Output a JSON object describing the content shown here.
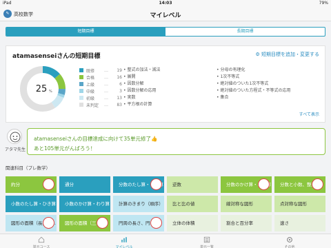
{
  "status_bar": {
    "device": "iPad",
    "time": "14:03",
    "battery": "79%"
  },
  "nav": {
    "app_label": "高校数学",
    "title": "マイレベル"
  },
  "segments": {
    "short_term": "短期目標",
    "long_term": "長期目標"
  },
  "goal_card": {
    "title": "atamasenseiさんの短期目標",
    "add_change": "短期目標を追加・変更する",
    "percent": "25",
    "percent_unit": "%",
    "legend": [
      {
        "name": "既修",
        "count": "19",
        "color": "#2a9fbe"
      },
      {
        "name": "合格",
        "count": "16",
        "color": "#8cc63f"
      },
      {
        "name": "上級",
        "count": "6",
        "color": "#5aa5c8"
      },
      {
        "name": "中級",
        "count": "3",
        "color": "#9fd6e8"
      },
      {
        "name": "初級",
        "count": "13",
        "color": "#cde8f2"
      },
      {
        "name": "未判定",
        "count": "83",
        "color": "#e0e0e0"
      }
    ],
    "topics_col1": [
      "整式の加法・減法",
      "展開",
      "因数分解",
      "因数分解の応用",
      "実数",
      "平方根の計算"
    ],
    "topics_col2": [
      "分母の有理化",
      "1次不等式",
      "絶対値のついた1次不等式",
      "絶対値のついた方程式・不等式の応用",
      "集合"
    ],
    "see_all": "すべて表示"
  },
  "teacher": {
    "label": "アタマ先生",
    "line1": "atamasenseiさんの目標達成に向けて35単元修了👍",
    "line2": "あと105単元がんばろう！"
  },
  "related_heading": "関連科目（プレ数学）",
  "tiles": [
    [
      {
        "label": "約分",
        "style": "green",
        "badge": true
      },
      {
        "label": "通分",
        "style": "dark",
        "badge": false
      },
      {
        "label": "分数のたし算・ひき算",
        "style": "dark",
        "badge": true
      },
      {
        "label": "逆数",
        "style": "lightg",
        "badge": false
      },
      {
        "label": "分数のかけ算・わり算",
        "style": "green",
        "badge": true
      },
      {
        "label": "分数と小数、整数",
        "style": "green",
        "badge": true
      }
    ],
    [
      {
        "label": "小数のたし算・ひき算",
        "style": "dark",
        "badge": false
      },
      {
        "label": "小数のかけ算・わり算",
        "style": "dark",
        "badge": false
      },
      {
        "label": "計算のきまり（順序）",
        "style": "lightb",
        "badge": false
      },
      {
        "label": "比と比の値",
        "style": "lightg",
        "badge": false
      },
      {
        "label": "線対称な図形",
        "style": "lightg",
        "badge": false
      },
      {
        "label": "点対称な図形",
        "style": "lightg",
        "badge": false
      }
    ],
    [
      {
        "label": "図形の面積（長方形…",
        "style": "lightb",
        "badge": true
      },
      {
        "label": "図形の面積（三…",
        "style": "green",
        "badge": true
      },
      {
        "label": "円周の長さ、円…",
        "style": "lightb",
        "badge": true
      },
      {
        "label": "立体の体積",
        "style": "pale",
        "badge": false
      },
      {
        "label": "割合と百分率",
        "style": "pale",
        "badge": false
      },
      {
        "label": "速さ",
        "style": "pale",
        "badge": false
      }
    ]
  ],
  "tabbar": [
    {
      "label": "単元コース",
      "icon": "home-icon",
      "active": false
    },
    {
      "label": "マイレベル",
      "icon": "bar-chart-icon",
      "active": true
    },
    {
      "label": "単元一覧",
      "icon": "list-icon",
      "active": false
    },
    {
      "label": "その他",
      "icon": "gear-icon",
      "active": false
    }
  ],
  "colors": {
    "accent": "#2a9fbe",
    "green": "#8cc63f"
  }
}
